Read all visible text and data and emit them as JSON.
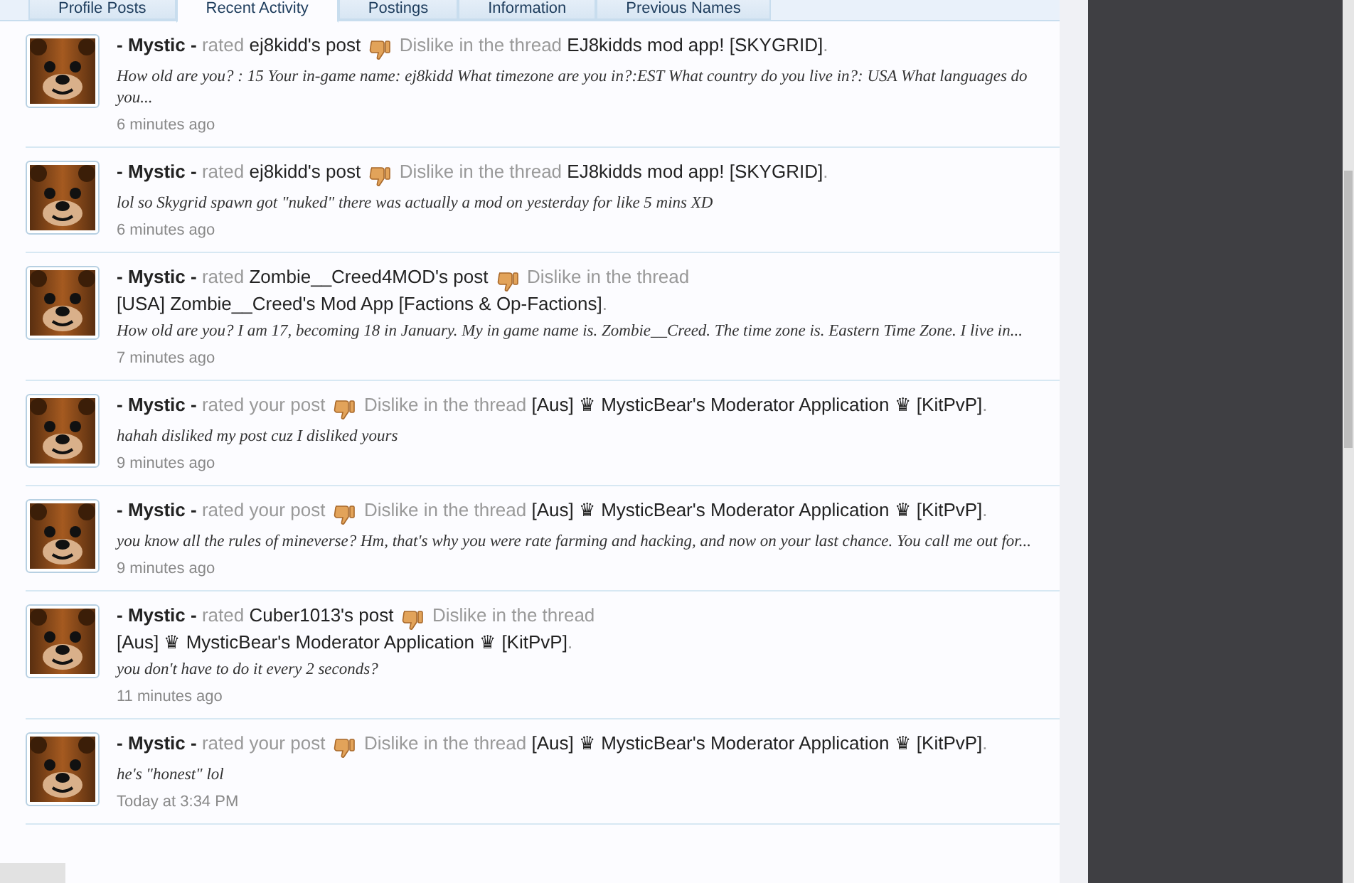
{
  "tabs": [
    {
      "label": "Profile Posts",
      "selected": false
    },
    {
      "label": "Recent Activity",
      "selected": true
    },
    {
      "label": "Postings",
      "selected": false
    },
    {
      "label": "Information",
      "selected": false
    },
    {
      "label": "Previous Names",
      "selected": false
    }
  ],
  "activities": [
    {
      "actor": "- Mystic -",
      "action": "rated",
      "target": "ej8kidd's post",
      "rating": "Dislike in the thread",
      "thread": "EJ8kidds mod app! [SKYGRID]",
      "end": ".",
      "snippet": "How old are you? : 15 Your in-game name: ej8kidd What timezone are you in?:EST What country do you live in?: USA What languages do you...",
      "time": "6 minutes ago"
    },
    {
      "actor": "- Mystic -",
      "action": "rated",
      "target": "ej8kidd's post",
      "rating": "Dislike in the thread",
      "thread": "EJ8kidds mod app! [SKYGRID]",
      "end": ".",
      "snippet": "lol so Skygrid spawn got \"nuked\" there was actually a mod on yesterday for like 5 mins XD",
      "time": "6 minutes ago"
    },
    {
      "actor": "- Mystic -",
      "action": "rated",
      "target": "Zombie__Creed4MOD's post",
      "rating": "Dislike in the thread",
      "thread": "[USA] Zombie__Creed's Mod App [Factions & Op-Factions]",
      "end": ".",
      "snippet": "How old are you? I am 17, becoming 18 in January. My in game name is. Zombie__Creed. The time zone is. Eastern Time Zone. I live in...",
      "time": "7 minutes ago"
    },
    {
      "actor": "- Mystic -",
      "action": "rated your post",
      "rating": "Dislike in the thread",
      "thread": "[Aus] ♛ MysticBear's Moderator Application ♛ [KitPvP]",
      "end": ".",
      "snippet": "hahah disliked my post cuz I disliked yours",
      "time": "9 minutes ago"
    },
    {
      "actor": "- Mystic -",
      "action": "rated your post",
      "rating": "Dislike in the thread",
      "thread": "[Aus] ♛ MysticBear's Moderator Application ♛ [KitPvP]",
      "end": ".",
      "snippet": "you know all the rules of mineverse? Hm, that's why you were rate farming and hacking, and now on your last chance. You call me out for...",
      "time": "9 minutes ago"
    },
    {
      "actor": "- Mystic -",
      "action": "rated",
      "target": "Cuber1013's post",
      "rating": "Dislike in the thread",
      "thread": "[Aus] ♛ MysticBear's Moderator Application ♛ [KitPvP]",
      "end": ".",
      "snippet": "you don't have to do it every 2 seconds?",
      "time": "11 minutes ago"
    },
    {
      "actor": "- Mystic -",
      "action": "rated your post",
      "rating": "Dislike in the thread",
      "thread": "[Aus] ♛ MysticBear's Moderator Application ♛ [KitPvP]",
      "end": ".",
      "snippet": "he's \"honest\" lol",
      "time": "Today at 3:34 PM"
    }
  ]
}
